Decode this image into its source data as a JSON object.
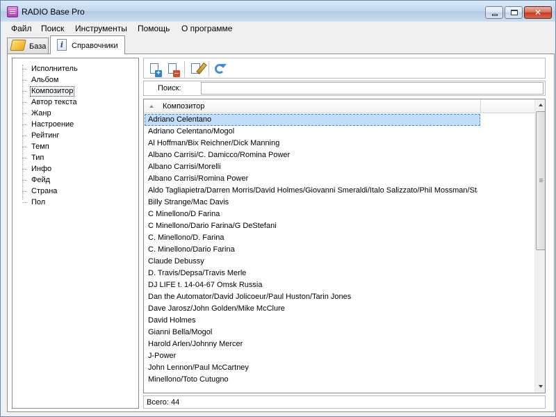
{
  "window": {
    "title": "RADIO Base Pro"
  },
  "menu": [
    "Файл",
    "Поиск",
    "Инструменты",
    "Помощь",
    "О программе"
  ],
  "tabs": [
    "База",
    "Справочники"
  ],
  "tree": {
    "items": [
      "Исполнитель",
      "Альбом",
      "Композитор",
      "Автор текста",
      "Жанр",
      "Настроение",
      "Рейтинг",
      "Темп",
      "Тип",
      "Инфо",
      "Фейд",
      "Страна",
      "Пол"
    ],
    "selected": "Композитор"
  },
  "toolbar": {
    "icons": [
      "add-record-icon",
      "delete-record-icon",
      "edit-record-icon",
      "refresh-icon"
    ]
  },
  "search": {
    "label": "Поиск:",
    "value": ""
  },
  "grid": {
    "column": "Композитор",
    "rows": [
      "Adriano Celentano",
      "Adriano Celentano/Mogol",
      "Al Hoffman/Bix Reichner/Dick Manning",
      "Albano Carrisi/C. Damicco/Romina Power",
      "Albano Carrisi/Morelli",
      "Albano Carrisi/Romina Power",
      "Aldo Tagliapietra/Darren Morris/David Holmes/Giovanni Smeraldi/Italo Salizzato/Phil Mossman/Stanl",
      "Billy Strange/Mac Davis",
      "C Minellono/D Farina",
      "C Minellono/Dario Farina/G DeStefani",
      "C. Minellono/D. Farina",
      "C. Minellono/Dario Farina",
      "Claude Debussy",
      "D. Travis/Depsa/Travis Merle",
      "DJ LIFE t. 14-04-67 Omsk Russia",
      "Dan the Automator/David Jolicoeur/Paul Huston/Tarin Jones",
      "Dave Jarosz/John Golden/Mike McClure",
      "David Holmes",
      "Gianni Bella/Mogol",
      "Harold Arlen/Johnny Mercer",
      "J-Power",
      "John Lennon/Paul McCartney",
      "Minellono/Toto Cutugno"
    ],
    "selected_index": 0
  },
  "status": {
    "text": "Всего: 44"
  }
}
